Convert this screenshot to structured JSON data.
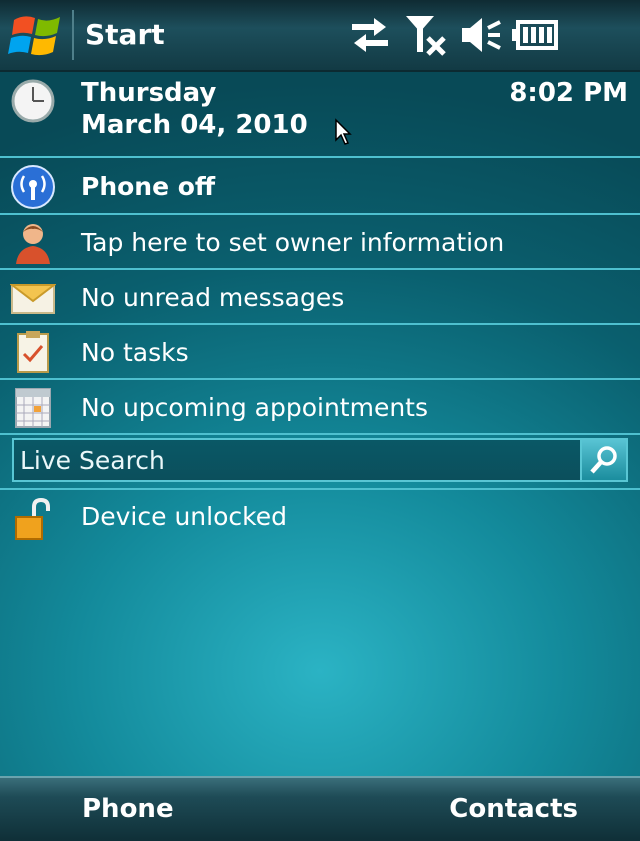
{
  "taskbar": {
    "start_label": "Start",
    "status_icons": [
      "sync-icon",
      "no-signal-icon",
      "volume-muted-icon",
      "battery-icon"
    ]
  },
  "today": {
    "day": "Thursday",
    "date": "March 04, 2010",
    "time": "8:02 PM",
    "items": {
      "phone": "Phone off",
      "owner": "Tap here to set owner information",
      "messages": "No unread messages",
      "tasks": "No tasks",
      "appointments": "No upcoming appointments",
      "device": "Device unlocked"
    },
    "search_label": "Live Search"
  },
  "softkeys": {
    "left": "Phone",
    "right": "Contacts"
  },
  "colors": {
    "accent": "#4ec0cf",
    "background": "#138a9b"
  }
}
